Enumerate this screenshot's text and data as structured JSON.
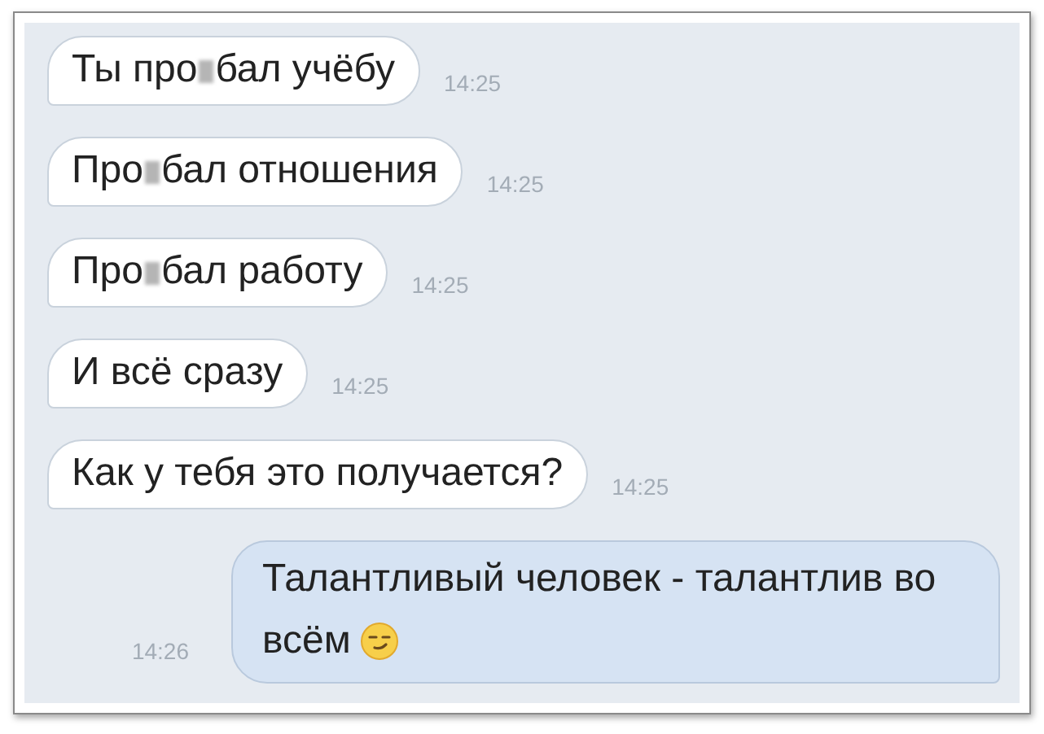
{
  "messages": [
    {
      "kind": "incoming",
      "parts": [
        "Ты про",
        "бал учёбу"
      ],
      "censored": true,
      "time": "14:25"
    },
    {
      "kind": "incoming",
      "parts": [
        "Про",
        "бал отношения"
      ],
      "censored": true,
      "time": "14:25"
    },
    {
      "kind": "incoming",
      "parts": [
        "Про",
        "бал работу"
      ],
      "censored": true,
      "time": "14:25"
    },
    {
      "kind": "incoming",
      "parts": [
        "И всё сразу"
      ],
      "time": "14:25"
    },
    {
      "kind": "incoming",
      "parts": [
        "Как у тебя это получается?"
      ],
      "time": "14:25"
    },
    {
      "kind": "outgoing",
      "parts": [
        "Талантливый человек - талантлив во всём"
      ],
      "has_emoji": true,
      "time": "14:26"
    }
  ]
}
